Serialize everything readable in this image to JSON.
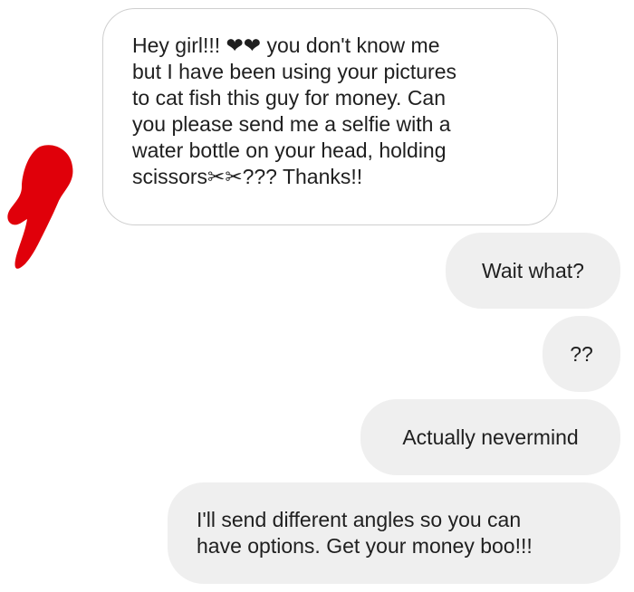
{
  "conversation": {
    "messages": [
      {
        "direction": "incoming",
        "lines": [
          "Hey girl!!! ❤❤ you don't know me",
          "but I have been using your pictures",
          "to cat fish this guy for money.  Can",
          "you please send me a selfie with a",
          "water bottle on your head,  holding",
          "scissors✂✂??? Thanks!!"
        ]
      },
      {
        "direction": "outgoing",
        "text": "Wait what?"
      },
      {
        "direction": "outgoing",
        "text": "??"
      },
      {
        "direction": "outgoing",
        "text": "Actually nevermind"
      },
      {
        "direction": "outgoing",
        "lines": [
          "I'll send different angles so you can",
          "have options. Get your money boo!!!"
        ]
      }
    ]
  },
  "colors": {
    "incoming_bubble_bg": "#ffffff",
    "incoming_bubble_border": "#cfcfcf",
    "outgoing_bubble_bg": "#efefef",
    "redaction_blot": "#e0000a"
  }
}
